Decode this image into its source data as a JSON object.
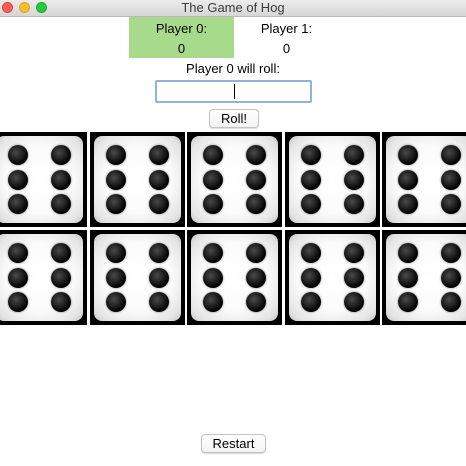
{
  "window": {
    "title": "The Game of Hog"
  },
  "players": [
    {
      "label": "Player 0:",
      "score": "0",
      "active": true,
      "highlight_color": "#a8da8c"
    },
    {
      "label": "Player 1:",
      "score": "0",
      "active": false
    }
  ],
  "turn": {
    "prompt": "Player 0 will roll:",
    "input_value": ""
  },
  "buttons": {
    "roll": "Roll!",
    "restart": "Restart"
  },
  "dice": [
    6,
    6,
    6,
    6,
    6,
    6,
    6,
    6,
    6,
    6
  ]
}
